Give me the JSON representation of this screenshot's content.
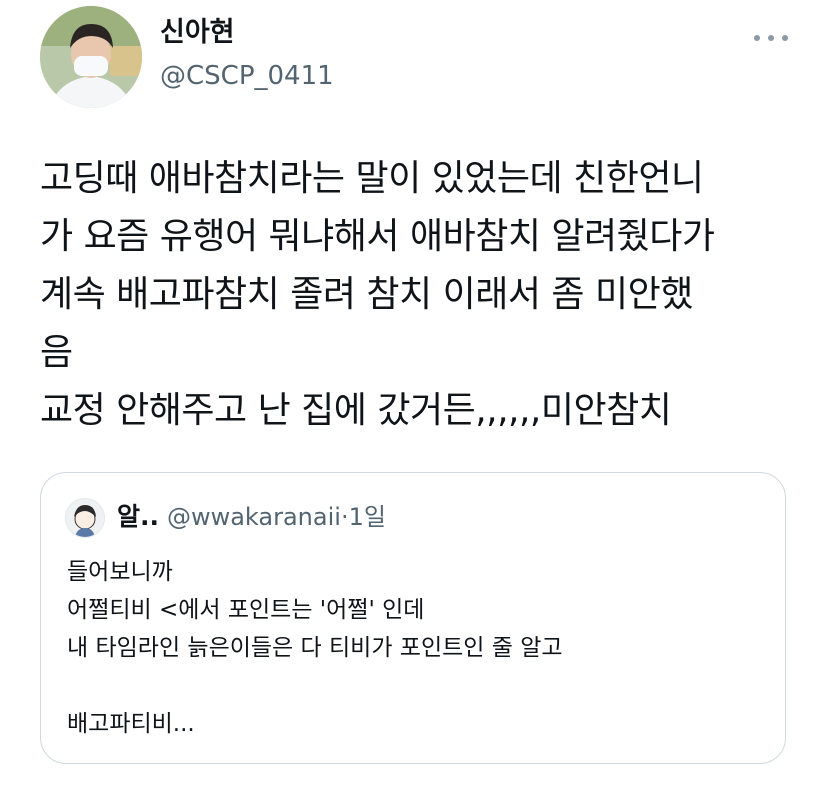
{
  "author": {
    "display_name": "신아현",
    "handle": "@CSCP_0411"
  },
  "tweet": {
    "text": "고딩때 애바참치라는 말이 있었는데 친한언니\n가 요즘 유행어 뭐냐해서 애바참치 알려줬다가\n계속 배고파참치 졸려 참치 이래서 좀 미안했\n음\n교정 안해주고 난 집에 갔거든,,,,,,미안참치"
  },
  "quoted_tweet": {
    "display_name": "알..",
    "handle": "@wwakaranaii",
    "separator": "·",
    "time": "1일",
    "text": "들어보니까\n어쩔티비 <에서 포인트는 '어쩔' 인데\n내 타임라인 늙은이들은 다 티비가 포인트인 줄 알고\n\n배고파티비..."
  },
  "icons": {
    "more": "more-horizontal-icon"
  },
  "colors": {
    "text_primary": "#0f1419",
    "text_secondary": "#536471",
    "border": "#cfd9de"
  }
}
